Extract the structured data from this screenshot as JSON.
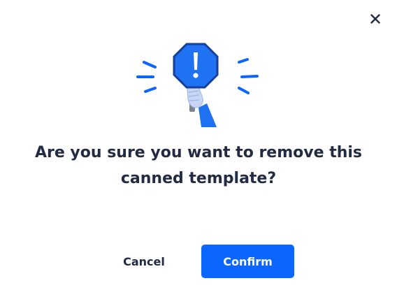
{
  "dialog": {
    "title": "Are you sure you want to remove this canned template?",
    "cancel_label": "Cancel",
    "confirm_label": "Confirm",
    "close_icon": "close-icon",
    "illustration_icon": "warning-sign-icon"
  },
  "colors": {
    "primary": "#0b66ff",
    "text": "#222a44",
    "background": "#ffffff"
  }
}
